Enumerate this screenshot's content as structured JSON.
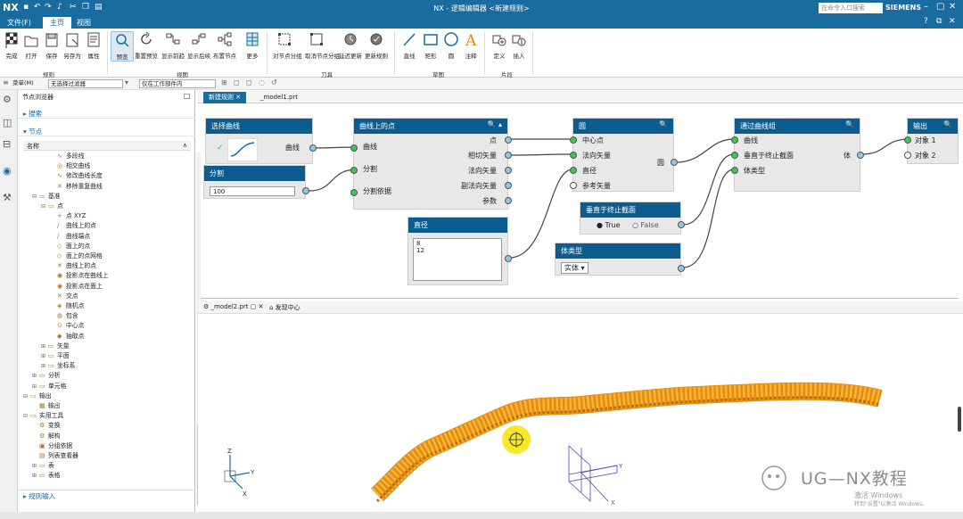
{
  "titlebar": {
    "app_short": "NX",
    "title": "NX - 逻辑编辑器 <新建规则>",
    "search_placeholder": "在命令入口搜索",
    "brand": "SIEMENS",
    "colors": {
      "bar": "#1a6b9f",
      "node_header": "#0c5c8f",
      "port_green": "#3cc65a",
      "tube": "#f0a020"
    }
  },
  "menu": {
    "file": "文件(F)",
    "home": "主页",
    "view": "视图"
  },
  "ribbon": {
    "buttons": [
      "完成",
      "打开",
      "保存",
      "另存为",
      "属性",
      "预览",
      "重置预览",
      "显示前趋",
      "显示后续",
      "布置节点",
      "更多",
      "对节点分组",
      "取消节点分组",
      "延迟更新",
      "更新规则",
      "直线",
      "矩形",
      "圆",
      "注释",
      "定义",
      "插入"
    ],
    "groups": [
      "规则",
      "视图",
      "刀具",
      "草图",
      "片段"
    ]
  },
  "filterbar": {
    "menu": "菜单(M)",
    "filter": "无选择过滤器",
    "scope": "仅在工作部件内"
  },
  "navigator": {
    "title": "节点浏览器",
    "search": "搜索",
    "nodes": "节点",
    "col_name": "名称",
    "footer": "规则输入",
    "tree": [
      {
        "label": "多段线",
        "indent": 3
      },
      {
        "label": "相交曲线",
        "indent": 3
      },
      {
        "label": "修改曲线长度",
        "indent": 3
      },
      {
        "label": "移除重复曲线",
        "indent": 3
      },
      {
        "label": "基准",
        "indent": 1,
        "exp": "−"
      },
      {
        "label": "点",
        "indent": 2,
        "exp": "−"
      },
      {
        "label": "点 XYZ",
        "indent": 3
      },
      {
        "label": "曲线上的点",
        "indent": 3
      },
      {
        "label": "曲线端点",
        "indent": 3
      },
      {
        "label": "面上的点",
        "indent": 3
      },
      {
        "label": "面上的点网格",
        "indent": 3
      },
      {
        "label": "曲线上的点",
        "indent": 3
      },
      {
        "label": "投影点在曲线上",
        "indent": 3
      },
      {
        "label": "投影点在面上",
        "indent": 3
      },
      {
        "label": "交点",
        "indent": 3
      },
      {
        "label": "随机点",
        "indent": 3
      },
      {
        "label": "包含",
        "indent": 3
      },
      {
        "label": "中心点",
        "indent": 3
      },
      {
        "label": "抽取点",
        "indent": 3
      },
      {
        "label": "矢量",
        "indent": 2,
        "exp": "+"
      },
      {
        "label": "平面",
        "indent": 2,
        "exp": "+"
      },
      {
        "label": "坐标系",
        "indent": 2,
        "exp": "+"
      },
      {
        "label": "分析",
        "indent": 1,
        "exp": "+"
      },
      {
        "label": "单元格",
        "indent": 1,
        "exp": "+"
      },
      {
        "label": "输出",
        "indent": 0,
        "exp": "−"
      },
      {
        "label": "输出",
        "indent": 1
      },
      {
        "label": "实用工具",
        "indent": 0,
        "exp": "−"
      },
      {
        "label": "变换",
        "indent": 1
      },
      {
        "label": "解构",
        "indent": 1
      },
      {
        "label": "分组依据",
        "indent": 1
      },
      {
        "label": "列表查看器",
        "indent": 1
      },
      {
        "label": "表",
        "indent": 1,
        "exp": "+"
      },
      {
        "label": "表格",
        "indent": 1,
        "exp": "+"
      }
    ]
  },
  "tabs": {
    "rule_tab": "新建规则",
    "part_tab": "_model1.prt",
    "model_tab": "_model2.prt",
    "disc_tab": "发现中心"
  },
  "nodes": {
    "select_curve": {
      "title": "选择曲线",
      "out": "曲线"
    },
    "divide": {
      "title": "分割",
      "value": "100"
    },
    "point_on_curve": {
      "title": "曲线上的点",
      "in": [
        "曲线",
        "分割",
        "分割依据"
      ],
      "out": [
        "点",
        "相切矢量",
        "法向矢量",
        "副法向矢量",
        "参数"
      ]
    },
    "circle": {
      "title": "圆",
      "in": [
        "中心点",
        "法向矢量",
        "直径",
        "参考矢量"
      ],
      "out": "圆"
    },
    "diameter": {
      "title": "直径",
      "values": [
        "8",
        "12"
      ]
    },
    "perp": {
      "title": "垂直于终止截面",
      "true_label": "True",
      "false_label": "False"
    },
    "body_type": {
      "title": "体类型",
      "value": "实体"
    },
    "through_curves": {
      "title": "通过曲线组",
      "in": [
        "曲线",
        "垂直于终止截面",
        "体类型"
      ],
      "out": "体"
    },
    "output": {
      "title": "输出",
      "in": [
        "对象 1",
        "对象 2"
      ]
    }
  },
  "viewport": {
    "watermark": "UG—NX教程",
    "activate": "激活 Windows",
    "activate_sub": "转到\"设置\"以激活 Windows。"
  }
}
